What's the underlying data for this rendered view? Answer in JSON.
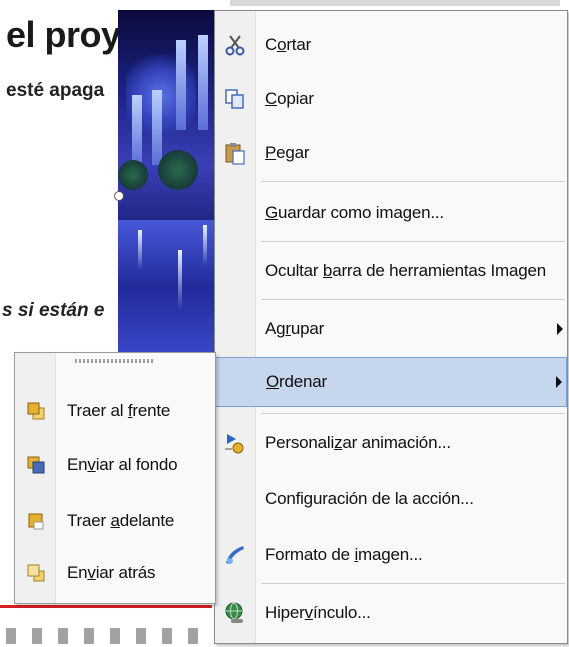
{
  "document": {
    "title": "el proy",
    "line1": "esté apaga",
    "line2": "s si están e"
  },
  "context_menu": {
    "items": [
      {
        "label_pre": "C",
        "label_u": "o",
        "label_post": "rtar",
        "icon": "scissors-icon"
      },
      {
        "label_pre": "",
        "label_u": "C",
        "label_post": "opiar",
        "icon": "copy-icon"
      },
      {
        "label_pre": "",
        "label_u": "P",
        "label_post": "egar",
        "icon": "paste-icon"
      },
      {
        "label_pre": "",
        "label_u": "G",
        "label_post": "uardar como imagen...",
        "icon": ""
      },
      {
        "label_pre": "Ocultar ",
        "label_u": "b",
        "label_post": "arra de herramientas Imagen",
        "icon": ""
      },
      {
        "label_pre": "Ag",
        "label_u": "r",
        "label_post": "upar",
        "icon": "",
        "submenu": true
      },
      {
        "label_pre": "",
        "label_u": "O",
        "label_post": "rdenar",
        "icon": "",
        "submenu": true,
        "highlighted": true
      },
      {
        "label_pre": "Personali",
        "label_u": "z",
        "label_post": "ar animación...",
        "icon": "custom-animation-icon"
      },
      {
        "label_pre": "Configuración de la acción...",
        "label_u": "",
        "label_post": "",
        "icon": ""
      },
      {
        "label_pre": "Formato de ",
        "label_u": "i",
        "label_post": "magen...",
        "icon": "format-picture-icon"
      },
      {
        "label_pre": "Hiper",
        "label_u": "v",
        "label_post": "ínculo...",
        "icon": "hyperlink-icon"
      }
    ]
  },
  "submenu": {
    "items": [
      {
        "label_pre": "Traer al ",
        "label_u": "f",
        "label_post": "rente",
        "icon": "bring-to-front-icon"
      },
      {
        "label_pre": "En",
        "label_u": "v",
        "label_post": "iar al fondo",
        "icon": "send-to-back-icon"
      },
      {
        "label_pre": "Traer ",
        "label_u": "a",
        "label_post": "delante",
        "icon": "bring-forward-icon"
      },
      {
        "label_pre": "En",
        "label_u": "v",
        "label_post": "iar atrás",
        "icon": "send-backward-icon"
      }
    ]
  },
  "colors": {
    "menu_bg": "#f9f9f9",
    "highlight": "#c6d6ec",
    "highlight_border": "#7aa0d4",
    "accent_red": "#d42020"
  }
}
